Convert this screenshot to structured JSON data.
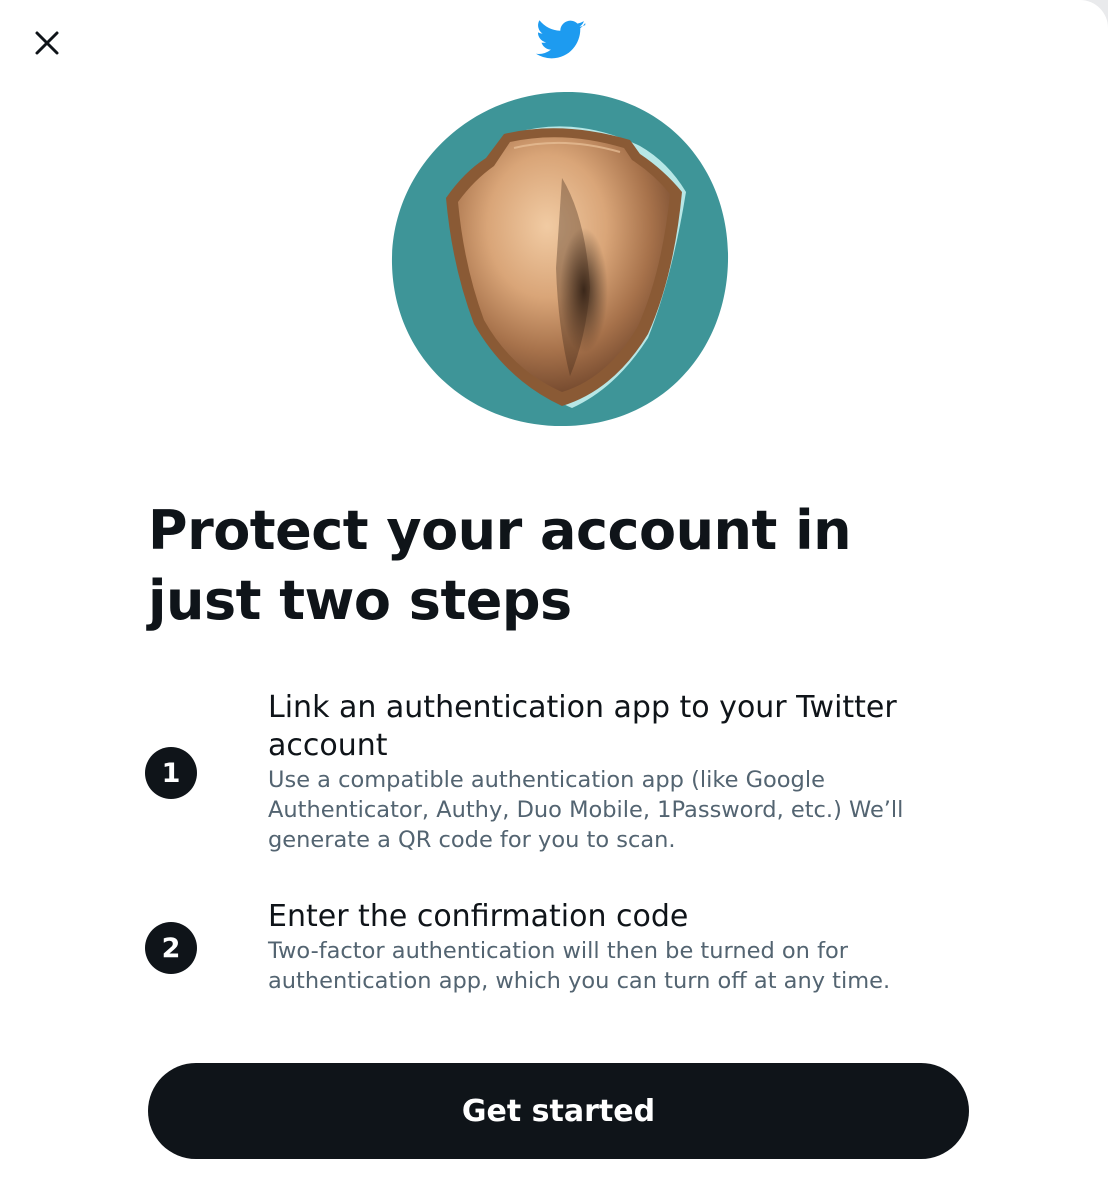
{
  "header": {
    "close_icon": "close-icon",
    "logo_icon": "twitter-bird-icon",
    "logo_color": "#1d9bf0"
  },
  "hero": {
    "icon": "shield-icon",
    "background_color": "#3e9598"
  },
  "title": "Protect your account in just two steps",
  "steps": [
    {
      "number": "1",
      "title": "Link an authentication app to your Twitter account",
      "description": "Use a compatible authentication app (like Google Authenticator, Authy, Duo Mobile, 1Password, etc.) We’ll generate a QR code for you to scan."
    },
    {
      "number": "2",
      "title": "Enter the confirmation code",
      "description": "Two-factor authentication will then be turned on for authentication app, which you can turn off at any time."
    }
  ],
  "cta": {
    "label": "Get started"
  }
}
